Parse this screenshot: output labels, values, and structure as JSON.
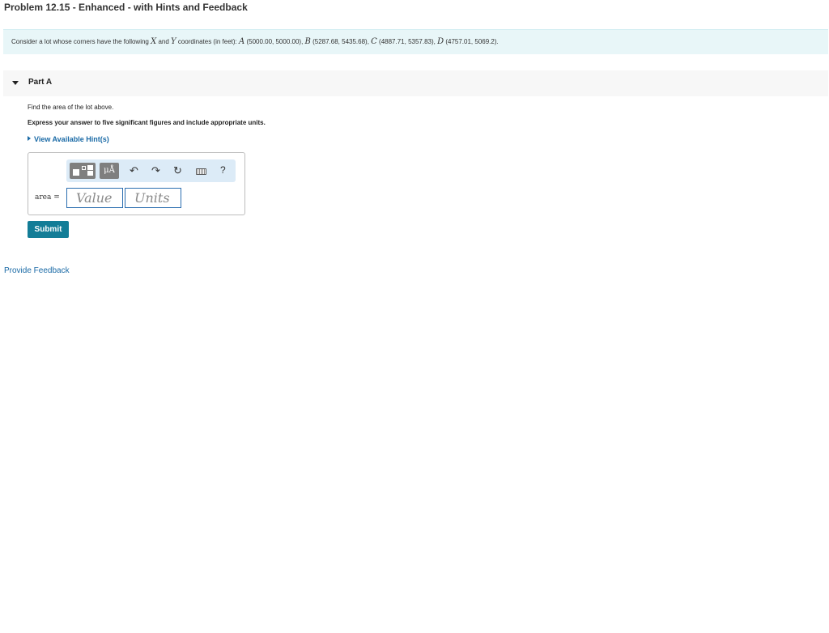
{
  "problem": {
    "title": "Problem 12.15 - Enhanced - with Hints and Feedback",
    "statement": {
      "prefix": "Consider a lot whose corners have the following ",
      "x_var": "X",
      "and": " and ",
      "y_var": "Y",
      "coords_intro": " coordinates (in feet): ",
      "a_label": "A",
      "a_coords": " (5000.00, 5000.00), ",
      "b_label": "B",
      "b_coords": " (5287.68, 5435.68), ",
      "c_label": "C",
      "c_coords": " (4887.71, 5357.83), ",
      "d_label": "D",
      "d_coords": " (4757.01, 5069.2)."
    }
  },
  "part": {
    "label": "Part A",
    "question": "Find the area of the lot above.",
    "instruction": "Express your answer to five significant figures and include appropriate units.",
    "hint_link": "View Available Hint(s)"
  },
  "answer": {
    "variable_label": "area =",
    "value_placeholder": "Value",
    "units_placeholder": "Units",
    "toolbar": {
      "symbols_label": "μÅ",
      "undo_glyph": "↶",
      "redo_glyph": "↷",
      "reset_glyph": "↻",
      "help_glyph": "?"
    }
  },
  "submit_label": "Submit",
  "feedback_link": "Provide Feedback",
  "colors": {
    "problem_bg": "#e8f6f8",
    "link": "#1a6aa6",
    "submit": "#137d97",
    "toolbar_bg": "#dcebf7"
  }
}
